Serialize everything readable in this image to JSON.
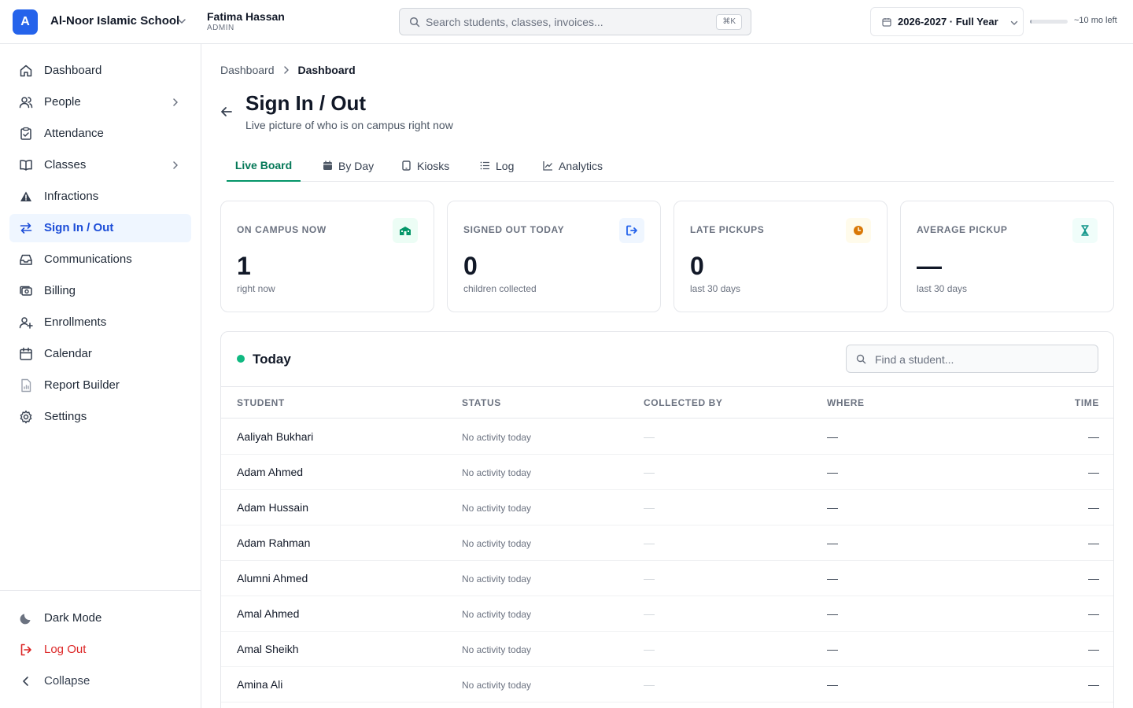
{
  "topbar": {
    "logo_letter": "A",
    "school_name": "Al-Noor Islamic School",
    "user_name": "Fatima Hassan",
    "user_role": "ADMIN",
    "search_placeholder": "Search students, classes, invoices...",
    "search_shortcut": "⌘K",
    "year_label": "2026-2027 · Full Year",
    "year_progress_fraction": 0.05,
    "year_remaining": "~10 mo left"
  },
  "sidebar": {
    "items": [
      {
        "label": "Dashboard",
        "icon": "home-icon"
      },
      {
        "label": "People",
        "icon": "users-icon",
        "has_children": true
      },
      {
        "label": "Attendance",
        "icon": "clipboard-check-icon"
      },
      {
        "label": "Classes",
        "icon": "book-open-icon",
        "has_children": true
      },
      {
        "label": "Infractions",
        "icon": "warning-icon"
      },
      {
        "label": "Sign In / Out",
        "icon": "arrows-exchange-icon",
        "active": true
      },
      {
        "label": "Communications",
        "icon": "inbox-icon"
      },
      {
        "label": "Billing",
        "icon": "cash-icon"
      },
      {
        "label": "Enrollments",
        "icon": "user-plus-icon"
      },
      {
        "label": "Calendar",
        "icon": "calendar-icon"
      },
      {
        "label": "Report Builder",
        "icon": "report-icon"
      },
      {
        "label": "Settings",
        "icon": "gear-icon"
      }
    ],
    "footer": {
      "dark_mode": "Dark Mode",
      "logout": "Log Out",
      "collapse": "Collapse"
    }
  },
  "breadcrumb": [
    "Dashboard",
    "Dashboard"
  ],
  "page": {
    "title": "Sign In / Out",
    "subtitle": "Live picture of who is on campus right now"
  },
  "tabs": [
    {
      "label": "Live Board",
      "active": true
    },
    {
      "label": "By Day",
      "icon": "calendar-icon"
    },
    {
      "label": "Kiosks",
      "icon": "tablet-icon"
    },
    {
      "label": "Log",
      "icon": "list-icon"
    },
    {
      "label": "Analytics",
      "icon": "chart-line-icon"
    }
  ],
  "stats": [
    {
      "label": "ON CAMPUS NOW",
      "value": "1",
      "sub": "right now",
      "icon": "school-icon",
      "color": "#059669",
      "bg": "#ecfdf5"
    },
    {
      "label": "SIGNED OUT TODAY",
      "value": "0",
      "sub": "children collected",
      "icon": "sign-out-icon",
      "color": "#2563eb",
      "bg": "#eff6ff"
    },
    {
      "label": "LATE PICKUPS",
      "value": "0",
      "sub": "last 30 days",
      "icon": "clock-icon",
      "color": "#d97706",
      "bg": "#fffbeb"
    },
    {
      "label": "AVERAGE PICKUP",
      "value": "—",
      "sub": "last 30 days",
      "icon": "hourglass-icon",
      "color": "#0d9488",
      "bg": "#f0fdfa"
    }
  ],
  "today": {
    "title": "Today",
    "find_placeholder": "Find a student...",
    "columns": [
      "STUDENT",
      "STATUS",
      "COLLECTED BY",
      "WHERE",
      "TIME"
    ],
    "rows": [
      {
        "student": "Aaliyah Bukhari",
        "status": "No activity today",
        "collected_by": "—",
        "where": "—",
        "time": "—"
      },
      {
        "student": "Adam Ahmed",
        "status": "No activity today",
        "collected_by": "—",
        "where": "—",
        "time": "—"
      },
      {
        "student": "Adam Hussain",
        "status": "No activity today",
        "collected_by": "—",
        "where": "—",
        "time": "—"
      },
      {
        "student": "Adam Rahman",
        "status": "No activity today",
        "collected_by": "—",
        "where": "—",
        "time": "—"
      },
      {
        "student": "Alumni Ahmed",
        "status": "No activity today",
        "collected_by": "—",
        "where": "—",
        "time": "—"
      },
      {
        "student": "Amal Ahmed",
        "status": "No activity today",
        "collected_by": "—",
        "where": "—",
        "time": "—"
      },
      {
        "student": "Amal Sheikh",
        "status": "No activity today",
        "collected_by": "—",
        "where": "—",
        "time": "—"
      },
      {
        "student": "Amina Ali",
        "status": "No activity today",
        "collected_by": "—",
        "where": "—",
        "time": "—"
      }
    ]
  }
}
